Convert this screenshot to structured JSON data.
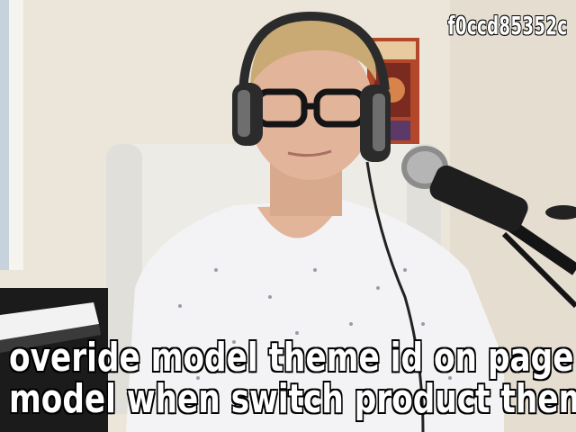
{
  "overlay": {
    "hash_label": "f0ccd85352c",
    "caption_lines": [
      "overide model theme id on page",
      "model when switch product them"
    ]
  },
  "scene": {
    "colors": {
      "wall": "#ece6da",
      "chair": "#ecebe6",
      "shirt": "#f3f3f5",
      "skin": "#e2b49a",
      "hair": "#c9aa74",
      "headphones": "#2b2b2b",
      "microphone": "#1e1e1e",
      "poster": "#b2472a",
      "keyboard": "#1b1b1b"
    }
  }
}
